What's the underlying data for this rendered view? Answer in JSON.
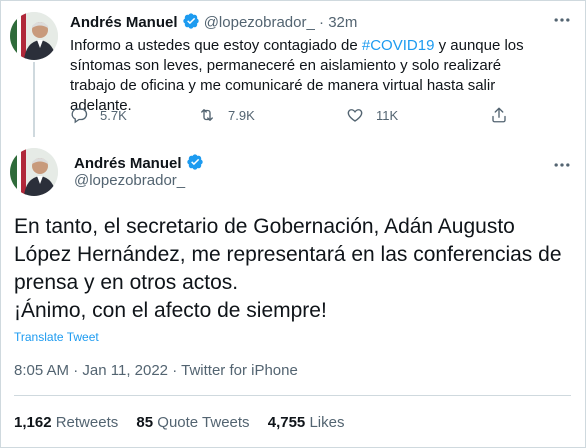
{
  "tweet1": {
    "display_name": "Andrés Manuel",
    "handle": "@lopezobrador_",
    "separator": "·",
    "time_ago": "32m",
    "text_before": "Informo a ustedes que estoy contagiado de ",
    "hashtag": "#COVID19",
    "text_after": " y aunque los síntomas son leves, permaneceré en aislamiento y solo realizaré trabajo de oficina y me comunicaré de manera virtual hasta salir adelante.",
    "replies": "5.7K",
    "retweets": "7.9K",
    "likes": "11K",
    "icons": {
      "reply": "reply-icon",
      "retweet": "retweet-icon",
      "like": "like-icon",
      "share": "share-icon",
      "more": "more-icon"
    }
  },
  "tweet2": {
    "display_name": "Andrés Manuel",
    "handle": "@lopezobrador_",
    "text_line1": "En tanto, el secretario de Gobernación, Adán Augusto López Hernández, me representará en las conferencias de prensa y en otros actos.",
    "text_line2": "¡Ánimo, con el afecto de siempre!",
    "translate_label": "Translate Tweet",
    "time": "8:05 AM",
    "separator": "·",
    "date": "Jan 11, 2022",
    "source": "Twitter for iPhone",
    "retweets_count": "1,162",
    "retweets_label": "Retweets",
    "quotes_count": "85",
    "quotes_label": "Quote Tweets",
    "likes_count": "4,755",
    "likes_label": "Likes"
  },
  "colors": {
    "accent": "#1d9bf0",
    "muted": "#536471",
    "text": "#0f1419",
    "border": "#cfd9de"
  }
}
